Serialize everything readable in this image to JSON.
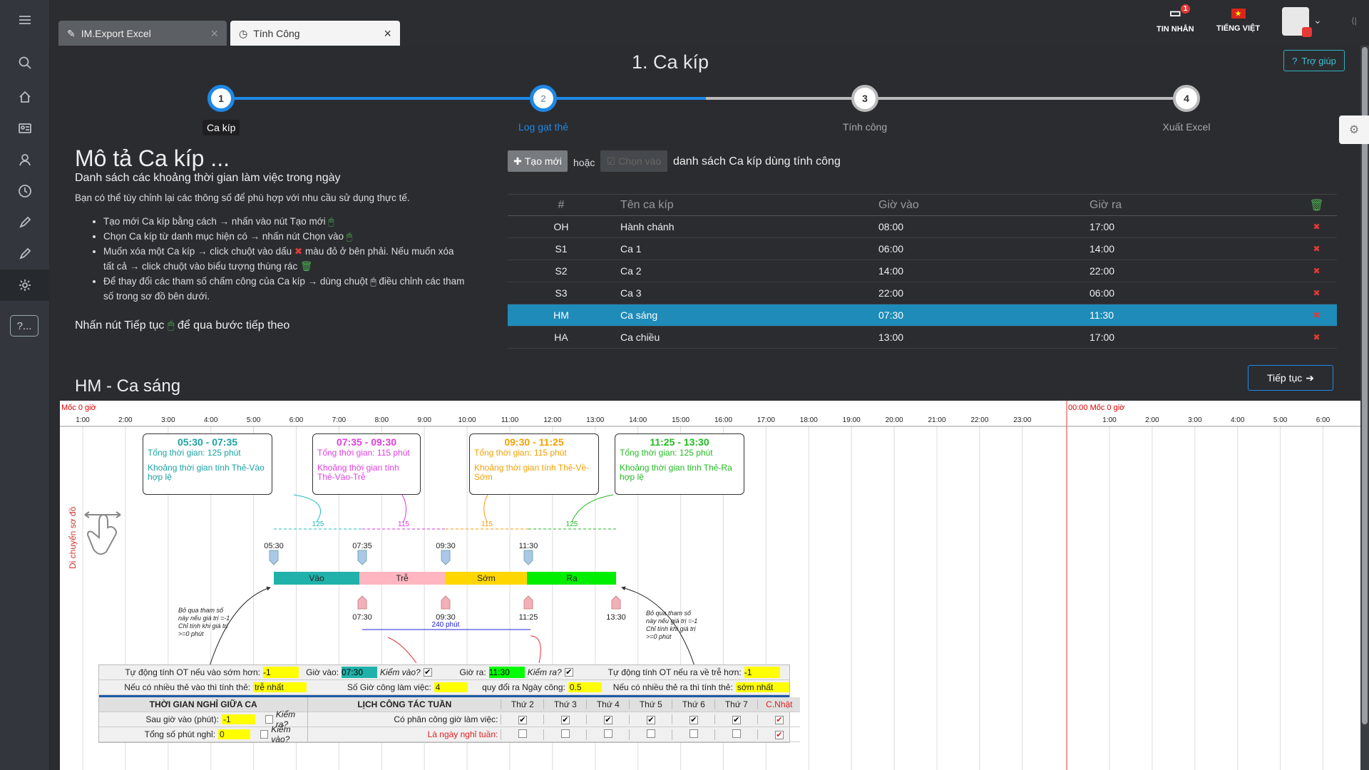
{
  "tabs": [
    {
      "label": "IM.Export Excel"
    },
    {
      "label": "Tính Công"
    }
  ],
  "topbar": {
    "messages_label": "TIN NHẮN",
    "messages_badge": "1",
    "language_label": "TIẾNG VIỆT"
  },
  "help_label": "Trợ giúp",
  "page_title": "1. Ca kíp",
  "steps": [
    {
      "num": "1",
      "label": "Ca kíp"
    },
    {
      "num": "2",
      "label": "Log gạt thẻ"
    },
    {
      "num": "3",
      "label": "Tính công"
    },
    {
      "num": "4",
      "label": "Xuất Excel"
    }
  ],
  "desc": {
    "title": "Mô tả Ca kíp ...",
    "subtitle": "Danh sách các khoảng thời gian làm việc trong ngày",
    "intro": "Bạn có thể tùy chỉnh lại các thông số để phù hợp với nhu cầu sử dụng thực tế.",
    "items": [
      "Tạo mới Ca kíp bằng cách → nhấn vào nút Tạo mới",
      "Chọn Ca kíp từ danh mục hiện có → nhấn nút Chọn vào",
      "Muốn xóa một Ca kíp → click chuột vào dấu",
      "màu đỏ ở bên phải. Nếu muốn xóa tất cả → click chuột vào biểu tượng thùng rác",
      "Để thay đổi các tham số chấm công của Ca kíp → dùng chuột",
      "điều chỉnh các tham số trong sơ đồ bên dưới."
    ],
    "footer_a": "Nhấn nút Tiếp tục",
    "footer_b": "để qua bước tiếp theo"
  },
  "actions": {
    "new_label": "Tạo mới",
    "or_label": "hoặc",
    "choose_label": "Chọn vào",
    "list_label": "danh sách Ca kíp dùng tính công"
  },
  "table": {
    "headers": [
      "#",
      "Tên ca kíp",
      "Giờ vào",
      "Giờ ra"
    ],
    "rows": [
      [
        "OH",
        "Hành chánh",
        "08:00",
        "17:00"
      ],
      [
        "S1",
        "Ca 1",
        "06:00",
        "14:00"
      ],
      [
        "S2",
        "Ca 2",
        "14:00",
        "22:00"
      ],
      [
        "S3",
        "Ca 3",
        "22:00",
        "06:00"
      ],
      [
        "HM",
        "Ca sáng",
        "07:30",
        "11:30"
      ],
      [
        "HA",
        "Ca chiều",
        "13:00",
        "17:00"
      ]
    ],
    "selected": 4
  },
  "next_label": "Tiếp tục",
  "section_title": "HM - Ca sáng",
  "timeline": {
    "origin_label": "Mốc 0 giờ",
    "origin_label2": "00:00 Mốc 0 giờ",
    "hours": [
      "1:00",
      "2:00",
      "3:00",
      "4:00",
      "5:00",
      "6:00",
      "7:00",
      "8:00",
      "9:00",
      "10:00",
      "11:00",
      "12:00",
      "13:00",
      "14:00",
      "15:00",
      "16:00",
      "17:00",
      "18:00",
      "19:00",
      "20:00",
      "21:00",
      "22:00",
      "23:00"
    ],
    "hours2": [
      "1:00",
      "2:00",
      "3:00",
      "4:00",
      "5:00",
      "6:00"
    ],
    "move_label": "Di chuyển sơ đồ",
    "boxes": [
      {
        "range": "05:30 - 07:35",
        "total": "Tổng thời gian: 125 phút",
        "desc": "Khoảng thời gian tính Thẻ-Vào hợp lệ",
        "color": "#1aa3a3"
      },
      {
        "range": "07:35 - 09:30",
        "total": "Tổng thời gian: 115 phút",
        "desc": "Khoảng thời gian tính Thẻ-Vào-Trễ",
        "color": "#e040e0"
      },
      {
        "range": "09:30 - 11:25",
        "total": "Tổng thời gian: 115 phút",
        "desc": "Khoảng thời gian tính Thẻ-Về-Sớm",
        "color": "#f5a000"
      },
      {
        "range": "11:25 - 13:30",
        "total": "Tổng thời gian: 125 phút",
        "desc": "Khoảng thời gian tính Thẻ-Ra hợp lệ",
        "color": "#22bb22"
      }
    ],
    "gaps": [
      "125",
      "115",
      "115",
      "125"
    ],
    "top_marks": [
      "05:30",
      "07:35",
      "09:30",
      "11:30"
    ],
    "bottom_marks": [
      "07:30",
      "09:30",
      "11:25",
      "13:30"
    ],
    "bars": [
      "Vào",
      "Trễ",
      "Sớm",
      "Ra"
    ],
    "span_label": "240 phút",
    "note": "Bỏ qua tham số này nếu giá trị =-1 Chỉ tính khi giá trị >=0 phút"
  },
  "params": {
    "ot_early_label": "Tự động tính OT nếu vào sớm hơn:",
    "ot_early": "-1",
    "in_label": "Giờ vào:",
    "in_val": "07:30",
    "check_in_label": "Kiểm vào?",
    "out_label": "Giờ ra:",
    "out_val": "11:30",
    "check_out_label": "Kiểm ra?",
    "ot_late_label": "Tự động tính OT nếu ra về trễ hơn:",
    "ot_late": "-1",
    "multi_in_label": "Nếu có nhiều thẻ vào thì tính thẻ:",
    "multi_in": "trễ nhất",
    "hours_label": "Số Giờ công làm việc:",
    "hours_val": "4",
    "day_label": "quy đổi ra Ngày công:",
    "day_val": "0.5",
    "multi_out_label": "Nếu có nhiều thẻ ra thì tính thẻ:",
    "multi_out": "sớm nhất",
    "break_title": "THỜI GIAN NGHỈ GIỮA CA",
    "after_in_label": "Sau giờ vào (phút):",
    "after_in": "-1",
    "break_check_out": "Kiểm ra?",
    "total_break_label": "Tổng số phút nghỉ:",
    "total_break": "0",
    "break_check_in": "Kiểm vào?",
    "week_title": "LỊCH CÔNG TÁC TUẦN",
    "days": [
      "Thứ 2",
      "Thứ 3",
      "Thứ 4",
      "Thứ 5",
      "Thứ 6",
      "Thứ 7",
      "C.Nhật"
    ],
    "work_label": "Có phân công giờ làm việc:",
    "off_label": "Là ngày nghỉ tuần:"
  },
  "colors": {
    "accent": "#1e88e5",
    "selected_row": "#1f8bb8",
    "delete": "#e53935",
    "trash": "#4caf50"
  }
}
